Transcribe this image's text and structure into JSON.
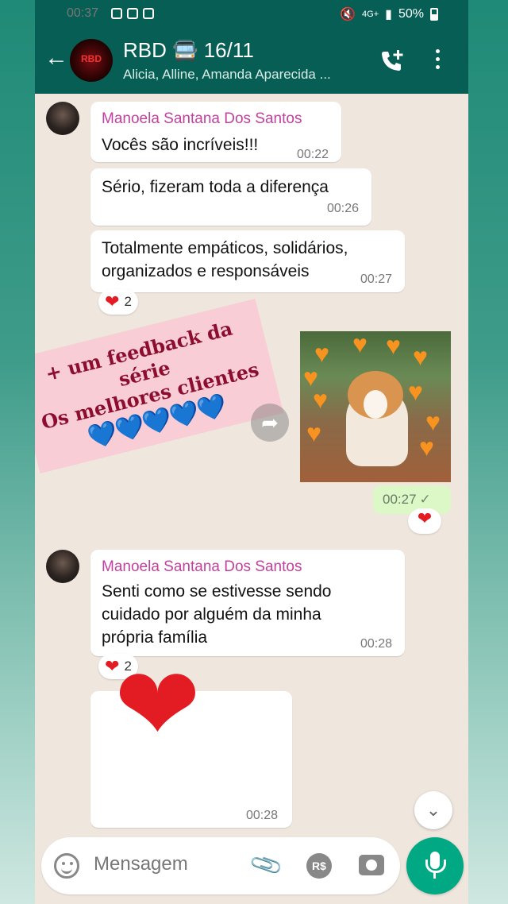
{
  "status_bar": {
    "time": "00:37",
    "network": "4G+",
    "battery": "50%"
  },
  "header": {
    "title": "RBD 🚍 16/11",
    "subtitle": "Alicia, Alline, Amanda Aparecida ..."
  },
  "messages": [
    {
      "sender": "Manoela Santana Dos Santos",
      "text": "Vocês são incríveis!!!",
      "time": "00:22"
    },
    {
      "text": "Sério, fizeram toda a diferença",
      "time": "00:26"
    },
    {
      "text": "Totalmente empáticos, solidários, organizados e responsáveis",
      "time": "00:27",
      "reaction": {
        "emoji": "❤",
        "count": "2"
      }
    },
    {
      "outgoing": true,
      "type": "image",
      "time": "00:27",
      "reaction": {
        "emoji": "❤"
      }
    },
    {
      "sender": "Manoela Santana Dos Santos",
      "text": "Senti como se estivesse sendo cuidado por alguém da minha própria família",
      "time": "00:28",
      "reaction": {
        "emoji": "❤",
        "count": "2"
      }
    },
    {
      "type": "emoji",
      "text": "❤",
      "time": "00:28"
    }
  ],
  "overlay_note": {
    "line1": "+ um feedback da série",
    "line2": "Os melhores clientes",
    "hearts": "💙💙💙💙💙"
  },
  "composer": {
    "placeholder": "Mensagem",
    "pay_label": "R$"
  },
  "colors": {
    "header": "#075e54",
    "sender": "#c2409e",
    "outgoing": "#dcf8c6",
    "accent": "#00a884"
  }
}
